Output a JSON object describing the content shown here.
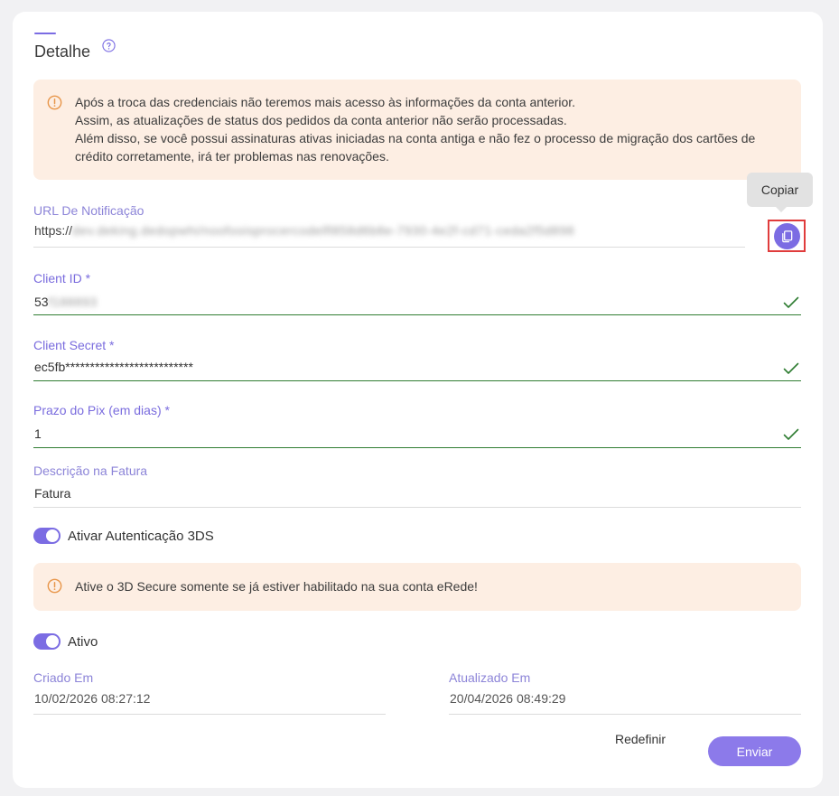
{
  "header": {
    "title": "Detalhe"
  },
  "warning_credentials": {
    "lines": [
      "Após a troca das credenciais não teremos mais acesso às informações da conta anterior.",
      "Assim, as atualizações de status dos pedidos da conta anterior não serão processadas.",
      "Além disso, se você possui assinaturas ativas iniciadas na conta antiga e não fez o processo de migração dos cartões de",
      "crédito corretamente, irá ter problemas nas renovações."
    ]
  },
  "notification_url": {
    "label": "URL De Notificação",
    "prefix": "https://",
    "masked_value": "dev.deking.dedopwhi/noofooisprocercodelfl858d6b8e-7930-4e2f-cd71-ceda2f5d898"
  },
  "copy_tooltip": "Copiar",
  "client_id": {
    "label": "Client ID *",
    "value_visible": "53",
    "value_masked": "f188893"
  },
  "client_secret": {
    "label": "Client Secret *",
    "value": "ec5fb**************************"
  },
  "pix_deadline": {
    "label": "Prazo do Pix (em dias) *",
    "value": "1"
  },
  "invoice_description": {
    "label": "Descrição na Fatura",
    "value": "Fatura"
  },
  "toggle_3ds": {
    "label": "Ativar Autenticação 3DS",
    "on": true
  },
  "warning_3ds": {
    "text": "Ative o 3D Secure somente se já estiver habilitado na sua conta eRede!"
  },
  "toggle_active": {
    "label": "Ativo",
    "on": true
  },
  "created_at": {
    "label": "Criado Em",
    "value": "10/02/2026 08:27:12"
  },
  "updated_at": {
    "label": "Atualizado Em",
    "value": "20/04/2026 08:49:29"
  },
  "actions": {
    "reset_label": "Redefinir",
    "submit_label": "Enviar"
  },
  "colors": {
    "accent": "#7b6ce3",
    "warning_bg": "#fdeee3",
    "warning_icon": "#e8964a",
    "valid": "#2f7d32"
  },
  "icons": [
    "help-circle-icon",
    "warning-circle-icon",
    "copy-icon",
    "check-icon"
  ]
}
